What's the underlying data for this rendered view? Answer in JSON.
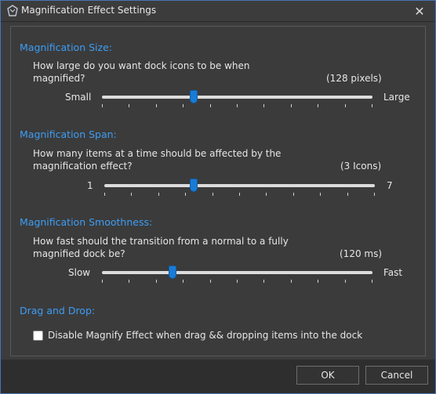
{
  "window": {
    "title": "Magnification Effect Settings",
    "close_glyph": "✕"
  },
  "sections": {
    "size": {
      "header": "Magnification Size:",
      "description": "How large do you want dock icons to be when magnified?",
      "value_text": "(128 pixels)",
      "min_label": "Small",
      "max_label": "Large",
      "slider_position": 0.34
    },
    "span": {
      "header": "Magnification Span:",
      "description": "How many items at a time should be affected by the magnification effect?",
      "value_text": "(3 Icons)",
      "min_label": "1",
      "max_label": "7",
      "slider_position": 0.33
    },
    "smoothness": {
      "header": "Magnification Smoothness:",
      "description": "How fast should the transition from a normal to a fully magnified dock be?",
      "value_text": "(120 ms)",
      "min_label": "Slow",
      "max_label": "Fast",
      "slider_position": 0.26
    },
    "drag": {
      "header": "Drag and Drop:",
      "checkbox_label": "Disable Magnify Effect when drag && dropping items into the dock",
      "checked": false
    }
  },
  "buttons": {
    "ok": "OK",
    "cancel": "Cancel"
  },
  "colors": {
    "accent": "#3d9df5",
    "thumb": "#1a7bd6",
    "window_border": "#4a74b8"
  }
}
